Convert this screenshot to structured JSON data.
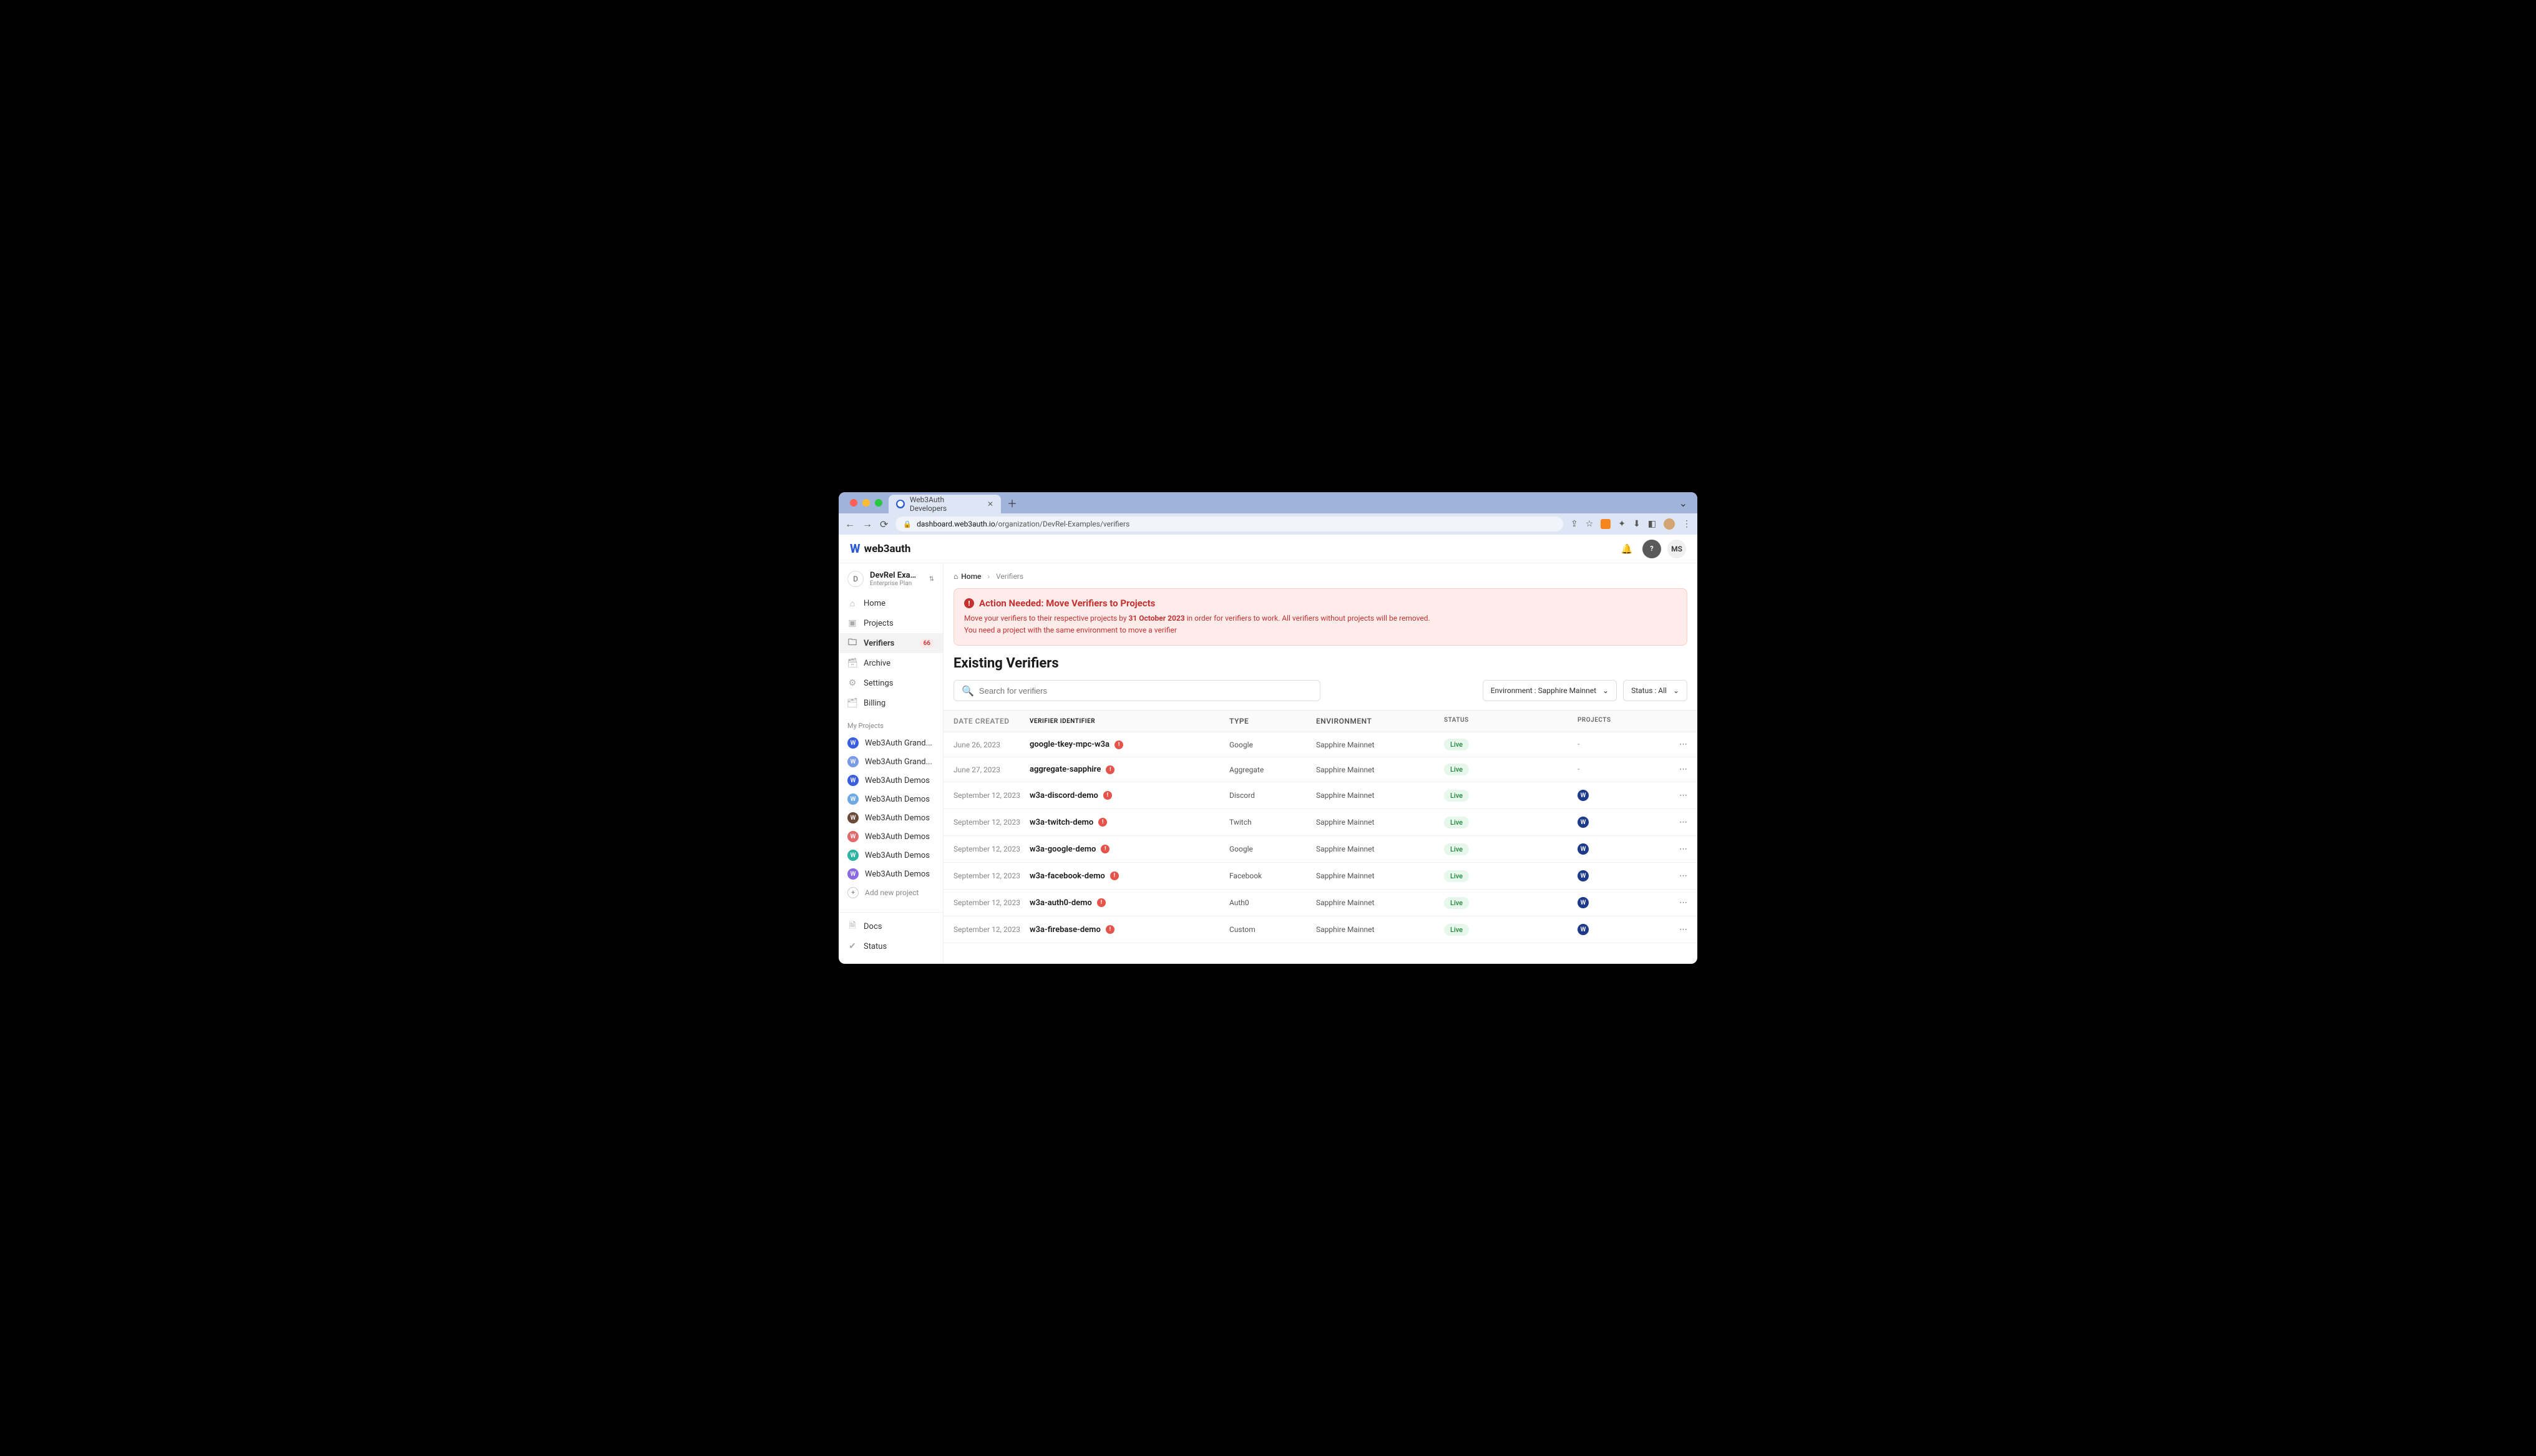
{
  "browser": {
    "tab_title": "Web3Auth Developers",
    "url_domain": "dashboard.web3auth.io",
    "url_path": "/organization/DevRel-Examples/verifiers"
  },
  "header": {
    "logo_text": "web3auth",
    "avatar_initials": "MS"
  },
  "org": {
    "initial": "D",
    "name": "DevRel Exampl...",
    "plan": "Enterprise Plan"
  },
  "nav": {
    "home": "Home",
    "projects": "Projects",
    "verifiers": "Verifiers",
    "verifiers_badge": "66",
    "archive": "Archive",
    "settings": "Settings",
    "billing": "Billing"
  },
  "my_projects_label": "My Projects",
  "projects": [
    {
      "name": "Web3Auth Grand...",
      "color": "#3b5ee0",
      "initial": "W"
    },
    {
      "name": "Web3Auth Grand...",
      "color": "#7a9ae8",
      "initial": "W"
    },
    {
      "name": "Web3Auth Demos",
      "color": "#3b5ee0",
      "initial": "W"
    },
    {
      "name": "Web3Auth Demos",
      "color": "#6ea8e6",
      "initial": "W"
    },
    {
      "name": "Web3Auth Demos",
      "color": "#6b4a3a",
      "initial": "W"
    },
    {
      "name": "Web3Auth Demos",
      "color": "#e06a6a",
      "initial": "W"
    },
    {
      "name": "Web3Auth Demos",
      "color": "#2fb3a3",
      "initial": "W"
    },
    {
      "name": "Web3Auth Demos",
      "color": "#8a6ae0",
      "initial": "W"
    }
  ],
  "add_project": "Add new project",
  "footer_nav": {
    "docs": "Docs",
    "status": "Status"
  },
  "breadcrumbs": {
    "home": "Home",
    "current": "Verifiers"
  },
  "alert": {
    "title": "Action Needed: Move Verifiers to Projects",
    "line1_a": "Move your verifiers to their respective projects by ",
    "line1_b": "31 October 2023",
    "line1_c": " in order for verifiers to work. All verifiers without projects will be removed.",
    "line2": "You need a project with the same environment to move a verifier"
  },
  "page_title": "Existing Verifiers",
  "search_placeholder": "Search for verifiers",
  "filter_env": "Environment : Sapphire Mainnet",
  "filter_status": "Status : All",
  "columns": {
    "date": "DATE CREATED",
    "id": "VERIFIER IDENTIFIER",
    "type": "TYPE",
    "env": "ENVIRONMENT",
    "status": "STATUS",
    "projects": "PROJECTS"
  },
  "rows": [
    {
      "date": "June 26, 2023",
      "id": "google-tkey-mpc-w3a",
      "type": "Google",
      "env": "Sapphire Mainnet",
      "status": "Live",
      "proj": "-"
    },
    {
      "date": "June 27, 2023",
      "id": "aggregate-sapphire",
      "type": "Aggregate",
      "env": "Sapphire Mainnet",
      "status": "Live",
      "proj": "-"
    },
    {
      "date": "September 12, 2023",
      "id": "w3a-discord-demo",
      "type": "Discord",
      "env": "Sapphire Mainnet",
      "status": "Live",
      "proj": "W"
    },
    {
      "date": "September 12, 2023",
      "id": "w3a-twitch-demo",
      "type": "Twitch",
      "env": "Sapphire Mainnet",
      "status": "Live",
      "proj": "W"
    },
    {
      "date": "September 12, 2023",
      "id": "w3a-google-demo",
      "type": "Google",
      "env": "Sapphire Mainnet",
      "status": "Live",
      "proj": "W"
    },
    {
      "date": "September 12, 2023",
      "id": "w3a-facebook-demo",
      "type": "Facebook",
      "env": "Sapphire Mainnet",
      "status": "Live",
      "proj": "W"
    },
    {
      "date": "September 12, 2023",
      "id": "w3a-auth0-demo",
      "type": "Auth0",
      "env": "Sapphire Mainnet",
      "status": "Live",
      "proj": "W"
    },
    {
      "date": "September 12, 2023",
      "id": "w3a-firebase-demo",
      "type": "Custom",
      "env": "Sapphire Mainnet",
      "status": "Live",
      "proj": "W"
    }
  ]
}
